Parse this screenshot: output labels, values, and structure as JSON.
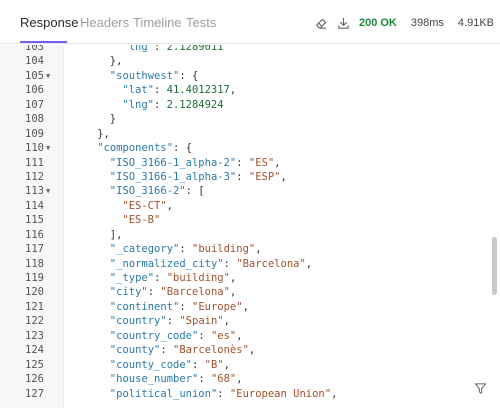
{
  "tabs": [
    {
      "label": "Response",
      "active": true
    },
    {
      "label": "Headers",
      "active": false
    },
    {
      "label": "Timeline",
      "active": false
    },
    {
      "label": "Tests",
      "active": false
    }
  ],
  "status": {
    "code_text": "200 OK",
    "time": "398ms",
    "size": "4.91KB",
    "ok_color": "#1a8a3a"
  },
  "icons": {
    "clear": "eraser-icon",
    "download": "download-icon",
    "filter": "filter-icon"
  },
  "accent_color": "#7a5cf0",
  "code_lines": [
    {
      "n": "103",
      "fold": false,
      "indent": 8,
      "tokens": [
        {
          "t": "k",
          "v": "\"lng\""
        },
        {
          "t": "p",
          "v": ": "
        },
        {
          "t": "n",
          "v": "2.1289011"
        }
      ]
    },
    {
      "n": "104",
      "fold": false,
      "indent": 6,
      "tokens": [
        {
          "t": "p",
          "v": "},"
        }
      ]
    },
    {
      "n": "105",
      "fold": true,
      "indent": 6,
      "tokens": [
        {
          "t": "k",
          "v": "\"southwest\""
        },
        {
          "t": "p",
          "v": ": {"
        }
      ]
    },
    {
      "n": "106",
      "fold": false,
      "indent": 8,
      "tokens": [
        {
          "t": "k",
          "v": "\"lat\""
        },
        {
          "t": "p",
          "v": ": "
        },
        {
          "t": "n",
          "v": "41.4012317"
        },
        {
          "t": "p",
          "v": ","
        }
      ]
    },
    {
      "n": "107",
      "fold": false,
      "indent": 8,
      "tokens": [
        {
          "t": "k",
          "v": "\"lng\""
        },
        {
          "t": "p",
          "v": ": "
        },
        {
          "t": "n",
          "v": "2.1284924"
        }
      ]
    },
    {
      "n": "108",
      "fold": false,
      "indent": 6,
      "tokens": [
        {
          "t": "p",
          "v": "}"
        }
      ]
    },
    {
      "n": "109",
      "fold": false,
      "indent": 4,
      "tokens": [
        {
          "t": "p",
          "v": "},"
        }
      ]
    },
    {
      "n": "110",
      "fold": true,
      "indent": 4,
      "tokens": [
        {
          "t": "k",
          "v": "\"components\""
        },
        {
          "t": "p",
          "v": ": {"
        }
      ]
    },
    {
      "n": "111",
      "fold": false,
      "indent": 6,
      "tokens": [
        {
          "t": "k",
          "v": "\"ISO_3166-1_alpha-2\""
        },
        {
          "t": "p",
          "v": ": "
        },
        {
          "t": "s",
          "v": "\"ES\""
        },
        {
          "t": "p",
          "v": ","
        }
      ]
    },
    {
      "n": "112",
      "fold": false,
      "indent": 6,
      "tokens": [
        {
          "t": "k",
          "v": "\"ISO_3166-1_alpha-3\""
        },
        {
          "t": "p",
          "v": ": "
        },
        {
          "t": "s",
          "v": "\"ESP\""
        },
        {
          "t": "p",
          "v": ","
        }
      ]
    },
    {
      "n": "113",
      "fold": true,
      "indent": 6,
      "tokens": [
        {
          "t": "k",
          "v": "\"ISO_3166-2\""
        },
        {
          "t": "p",
          "v": ": ["
        }
      ]
    },
    {
      "n": "114",
      "fold": false,
      "indent": 8,
      "tokens": [
        {
          "t": "s",
          "v": "\"ES-CT\""
        },
        {
          "t": "p",
          "v": ","
        }
      ]
    },
    {
      "n": "115",
      "fold": false,
      "indent": 8,
      "tokens": [
        {
          "t": "s",
          "v": "\"ES-B\""
        }
      ]
    },
    {
      "n": "116",
      "fold": false,
      "indent": 6,
      "tokens": [
        {
          "t": "p",
          "v": "],"
        }
      ]
    },
    {
      "n": "117",
      "fold": false,
      "indent": 6,
      "tokens": [
        {
          "t": "k",
          "v": "\"_category\""
        },
        {
          "t": "p",
          "v": ": "
        },
        {
          "t": "s",
          "v": "\"building\""
        },
        {
          "t": "p",
          "v": ","
        }
      ]
    },
    {
      "n": "118",
      "fold": false,
      "indent": 6,
      "tokens": [
        {
          "t": "k",
          "v": "\"_normalized_city\""
        },
        {
          "t": "p",
          "v": ": "
        },
        {
          "t": "s",
          "v": "\"Barcelona\""
        },
        {
          "t": "p",
          "v": ","
        }
      ]
    },
    {
      "n": "119",
      "fold": false,
      "indent": 6,
      "tokens": [
        {
          "t": "k",
          "v": "\"_type\""
        },
        {
          "t": "p",
          "v": ": "
        },
        {
          "t": "s",
          "v": "\"building\""
        },
        {
          "t": "p",
          "v": ","
        }
      ]
    },
    {
      "n": "120",
      "fold": false,
      "indent": 6,
      "tokens": [
        {
          "t": "k",
          "v": "\"city\""
        },
        {
          "t": "p",
          "v": ": "
        },
        {
          "t": "s",
          "v": "\"Barcelona\""
        },
        {
          "t": "p",
          "v": ","
        }
      ]
    },
    {
      "n": "121",
      "fold": false,
      "indent": 6,
      "tokens": [
        {
          "t": "k",
          "v": "\"continent\""
        },
        {
          "t": "p",
          "v": ": "
        },
        {
          "t": "s",
          "v": "\"Europe\""
        },
        {
          "t": "p",
          "v": ","
        }
      ]
    },
    {
      "n": "122",
      "fold": false,
      "indent": 6,
      "tokens": [
        {
          "t": "k",
          "v": "\"country\""
        },
        {
          "t": "p",
          "v": ": "
        },
        {
          "t": "s",
          "v": "\"Spain\""
        },
        {
          "t": "p",
          "v": ","
        }
      ]
    },
    {
      "n": "123",
      "fold": false,
      "indent": 6,
      "tokens": [
        {
          "t": "k",
          "v": "\"country_code\""
        },
        {
          "t": "p",
          "v": ": "
        },
        {
          "t": "s",
          "v": "\"es\""
        },
        {
          "t": "p",
          "v": ","
        }
      ]
    },
    {
      "n": "124",
      "fold": false,
      "indent": 6,
      "tokens": [
        {
          "t": "k",
          "v": "\"county\""
        },
        {
          "t": "p",
          "v": ": "
        },
        {
          "t": "s",
          "v": "\"Barcelonès\""
        },
        {
          "t": "p",
          "v": ","
        }
      ]
    },
    {
      "n": "125",
      "fold": false,
      "indent": 6,
      "tokens": [
        {
          "t": "k",
          "v": "\"county_code\""
        },
        {
          "t": "p",
          "v": ": "
        },
        {
          "t": "s",
          "v": "\"B\""
        },
        {
          "t": "p",
          "v": ","
        }
      ]
    },
    {
      "n": "126",
      "fold": false,
      "indent": 6,
      "tokens": [
        {
          "t": "k",
          "v": "\"house_number\""
        },
        {
          "t": "p",
          "v": ": "
        },
        {
          "t": "s",
          "v": "\"68\""
        },
        {
          "t": "p",
          "v": ","
        }
      ]
    },
    {
      "n": "127",
      "fold": false,
      "indent": 6,
      "tokens": [
        {
          "t": "k",
          "v": "\"political_union\""
        },
        {
          "t": "p",
          "v": ": "
        },
        {
          "t": "s",
          "v": "\"European Union\""
        },
        {
          "t": "p",
          "v": ","
        }
      ]
    }
  ]
}
